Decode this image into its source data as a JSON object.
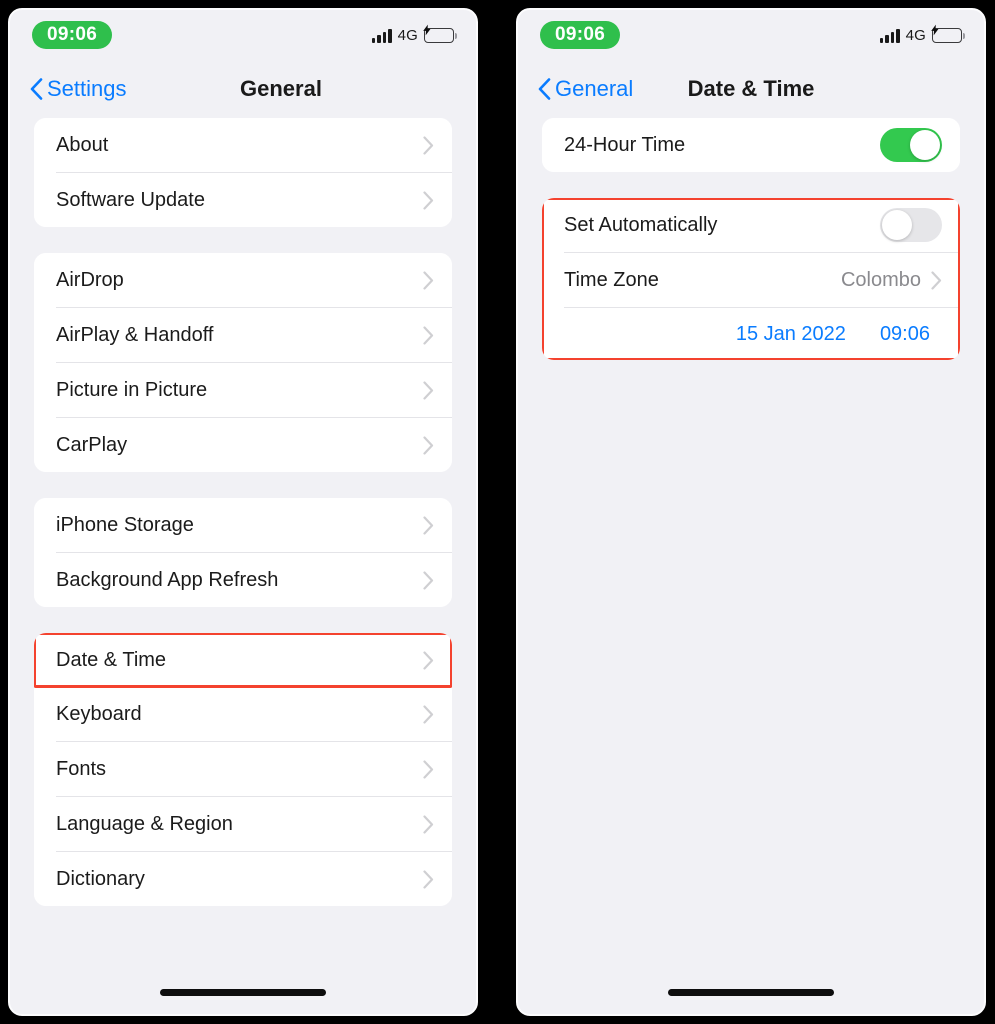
{
  "meta": {
    "accent_blue": "#0A7CFF",
    "toggle_on_green": "#33C94F",
    "highlight_red": "#F4422E",
    "status_badge_green": "#2FBF4C"
  },
  "screens": [
    {
      "id": "general",
      "status": {
        "time": "09:06",
        "network": "4G",
        "signal_icon": "signal-bars-icon",
        "battery_icon": "battery-charging-icon"
      },
      "nav": {
        "back_label": "Settings",
        "back_icon": "chevron-left-icon",
        "title": "General"
      },
      "groups": [
        {
          "rows": [
            {
              "label": "About",
              "accessory": "chevron-right-icon"
            },
            {
              "label": "Software Update",
              "accessory": "chevron-right-icon"
            }
          ]
        },
        {
          "rows": [
            {
              "label": "AirDrop",
              "accessory": "chevron-right-icon"
            },
            {
              "label": "AirPlay & Handoff",
              "accessory": "chevron-right-icon"
            },
            {
              "label": "Picture in Picture",
              "accessory": "chevron-right-icon"
            },
            {
              "label": "CarPlay",
              "accessory": "chevron-right-icon"
            }
          ]
        },
        {
          "rows": [
            {
              "label": "iPhone Storage",
              "accessory": "chevron-right-icon"
            },
            {
              "label": "Background App Refresh",
              "accessory": "chevron-right-icon"
            }
          ]
        },
        {
          "highlighted_row_index": 0,
          "rows": [
            {
              "label": "Date & Time",
              "accessory": "chevron-right-icon"
            },
            {
              "label": "Keyboard",
              "accessory": "chevron-right-icon"
            },
            {
              "label": "Fonts",
              "accessory": "chevron-right-icon"
            },
            {
              "label": "Language & Region",
              "accessory": "chevron-right-icon"
            },
            {
              "label": "Dictionary",
              "accessory": "chevron-right-icon"
            }
          ]
        }
      ]
    },
    {
      "id": "date-and-time",
      "status": {
        "time": "09:06",
        "network": "4G",
        "signal_icon": "signal-bars-icon",
        "battery_icon": "battery-charging-icon"
      },
      "nav": {
        "back_label": "General",
        "back_icon": "chevron-left-icon",
        "title": "Date & Time"
      },
      "rows": {
        "hour24": {
          "label": "24-Hour Time",
          "toggle": "on"
        },
        "set_automatically": {
          "label": "Set Automatically",
          "toggle": "off"
        },
        "time_zone": {
          "label": "Time Zone",
          "value": "Colombo",
          "accessory": "chevron-right-icon"
        },
        "date_value": "15 Jan 2022",
        "time_value": "09:06"
      },
      "highlight": "group-2"
    }
  ]
}
